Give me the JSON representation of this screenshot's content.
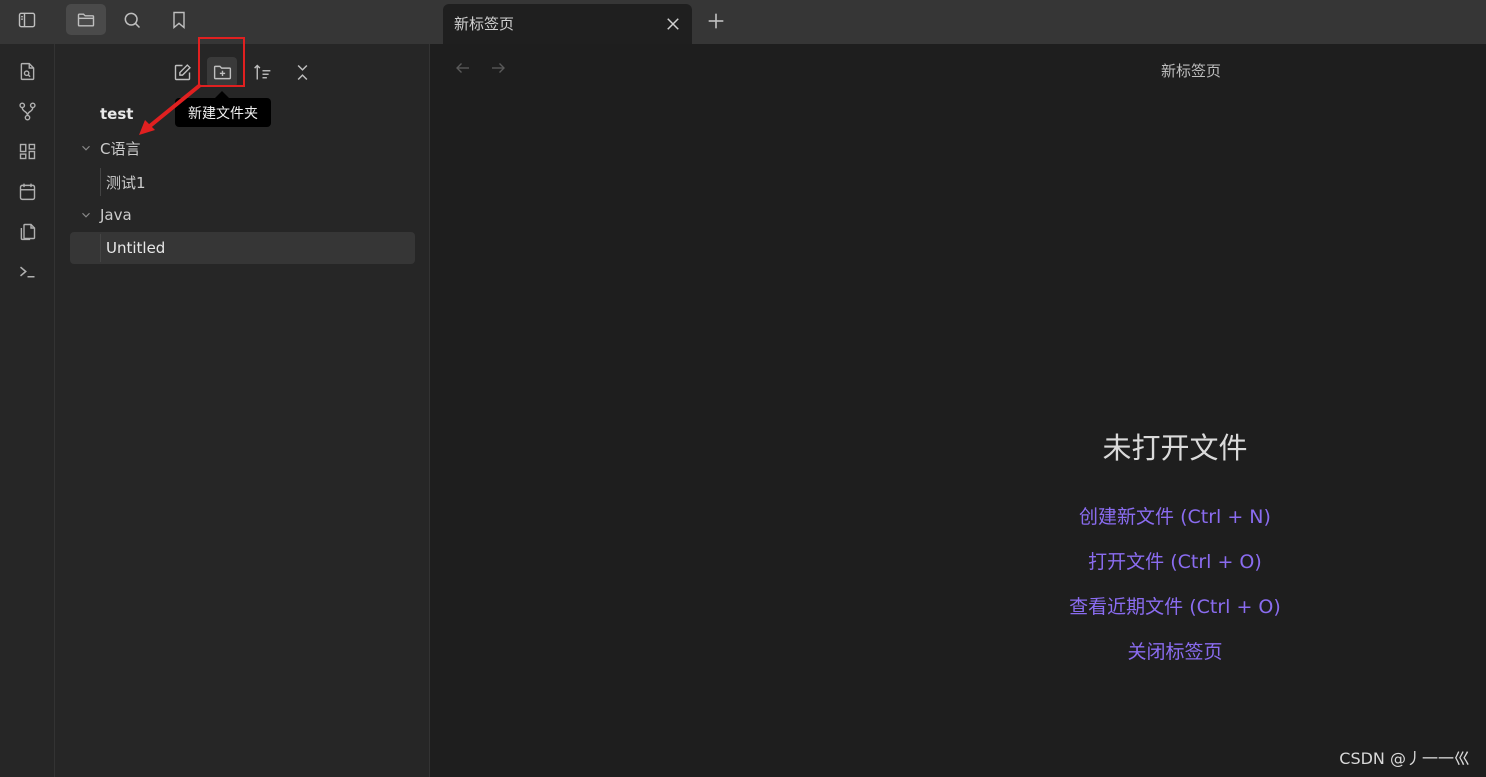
{
  "topbar": {
    "tab_title": "新标签页"
  },
  "sidebar": {
    "tooltip": "新建文件夹",
    "vault_name": "test",
    "tree": [
      {
        "label": "C语言",
        "type": "folder"
      },
      {
        "label": "测试1",
        "type": "file"
      },
      {
        "label": "Java",
        "type": "folder"
      },
      {
        "label": "Untitled",
        "type": "file",
        "selected": true
      }
    ]
  },
  "main": {
    "header_title": "新标签页",
    "empty_title": "未打开文件",
    "actions": [
      "创建新文件 (Ctrl + N)",
      "打开文件 (Ctrl + O)",
      "查看近期文件 (Ctrl + O)",
      "关闭标签页"
    ]
  },
  "watermark": "CSDN @丿一一巛",
  "colors": {
    "accent": "#8a6cf0",
    "highlight": "#e02020"
  },
  "icons": {
    "topbar": [
      "sidebar-toggle-icon",
      "folder-icon",
      "search-icon",
      "bookmark-icon"
    ],
    "ribbon": [
      "file-search-icon",
      "graph-icon",
      "layout-icon",
      "calendar-icon",
      "copy-icon",
      "terminal-icon"
    ],
    "sidebar_actions": [
      "new-note-icon",
      "new-folder-icon",
      "sort-icon",
      "collapse-icon"
    ]
  }
}
